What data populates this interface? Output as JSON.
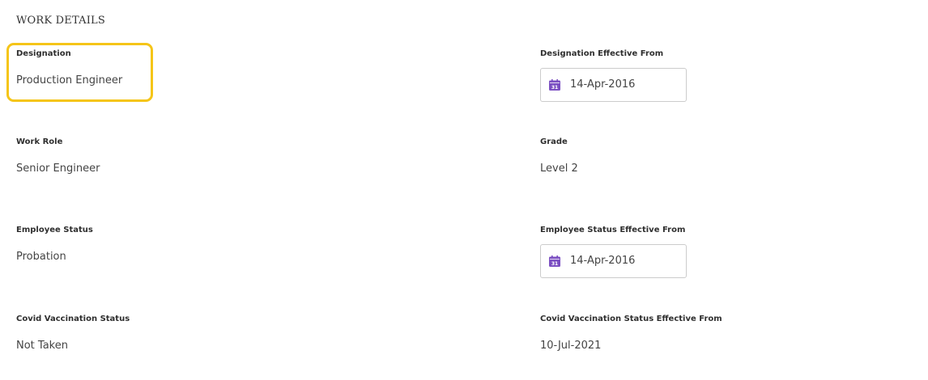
{
  "section": {
    "title": "WORK DETAILS"
  },
  "fields": {
    "designation": {
      "label": "Designation",
      "value": "Production Engineer"
    },
    "designation_effective_from": {
      "label": "Designation Effective From",
      "value": "14-Apr-2016"
    },
    "work_role": {
      "label": "Work Role",
      "value": "Senior Engineer"
    },
    "grade": {
      "label": "Grade",
      "value": "Level 2"
    },
    "employee_status": {
      "label": "Employee Status",
      "value": "Probation"
    },
    "employee_status_effective_from": {
      "label": "Employee Status Effective From",
      "value": "14-Apr-2016"
    },
    "covid_vaccination_status": {
      "label": "Covid Vaccination Status",
      "value": "Not Taken"
    },
    "covid_vaccination_status_effective_from": {
      "label": "Covid Vaccination Status Effective From",
      "value": "10-Jul-2021"
    }
  },
  "icons": {
    "date_picker": "calendar-icon",
    "calendar_day": "31"
  },
  "colors": {
    "highlight": "#f5c518",
    "calendar_icon": "#7b4fc2"
  }
}
